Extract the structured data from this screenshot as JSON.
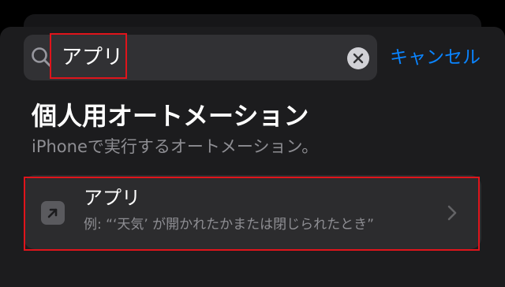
{
  "search": {
    "query": "アプリ",
    "clear_icon": "xmark-circle-fill-icon",
    "search_icon": "magnifyingglass-icon"
  },
  "cancel_label": "キャンセル",
  "section": {
    "title": "個人用オートメーション",
    "subtitle": "iPhoneで実行するオートメーション。"
  },
  "result": {
    "title": "アプリ",
    "subtitle": "例: “‘天気’ が開かれたかまたは閉じられたとき”",
    "icon": "arrow-up-right-square-icon",
    "chevron": "chevron-right-icon"
  },
  "colors": {
    "accent": "#0a84ff",
    "highlight": "#e0141b",
    "sheet_background": "#1c1c1e",
    "row_background": "#2c2c2e"
  }
}
